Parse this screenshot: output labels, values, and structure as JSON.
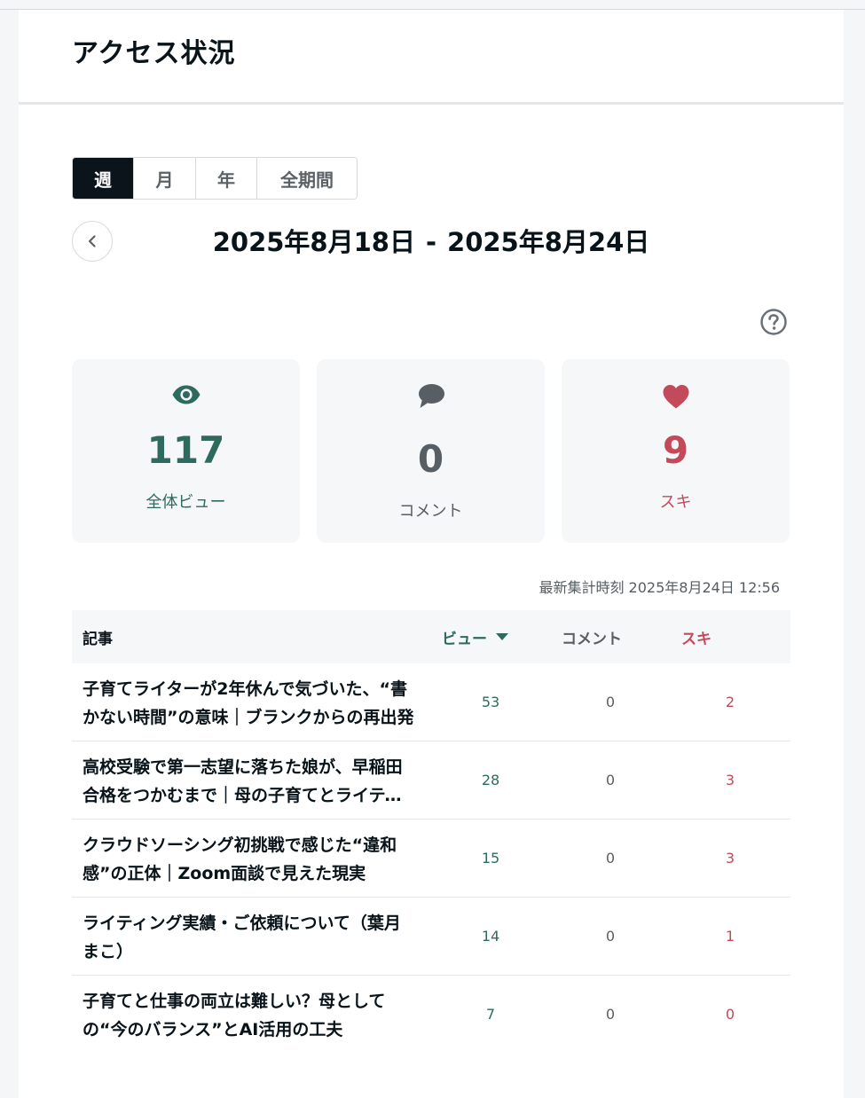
{
  "page": {
    "title": "アクセス状況"
  },
  "period_tabs": [
    {
      "label": "週",
      "active": true
    },
    {
      "label": "月",
      "active": false
    },
    {
      "label": "年",
      "active": false
    },
    {
      "label": "全期間",
      "active": false
    }
  ],
  "date_range": {
    "start": "2025年8月18日",
    "separator": "-",
    "end": "2025年8月24日"
  },
  "stats": {
    "views": {
      "value": "117",
      "label": "全体ビュー",
      "icon": "eye-icon",
      "color": "#2e6b5e"
    },
    "comments": {
      "value": "0",
      "label": "コメント",
      "icon": "speech-bubble-icon",
      "color": "#585f64"
    },
    "likes": {
      "value": "9",
      "label": "スキ",
      "icon": "heart-icon",
      "color": "#c34a5a"
    }
  },
  "updated_at": "最新集計時刻 2025年8月24日 12:56",
  "table": {
    "headers": {
      "article": "記事",
      "views": "ビュー",
      "comments": "コメント",
      "likes": "スキ"
    },
    "rows": [
      {
        "title": "子育てライターが2年休んで気づいた、“書かない時間”の意味｜ブランクからの再出発",
        "views": "53",
        "comments": "0",
        "likes": "2"
      },
      {
        "title": "高校受験で第一志望に落ちた娘が、早稲田合格をつかむまで｜母の子育てとライティング",
        "views": "28",
        "comments": "0",
        "likes": "3"
      },
      {
        "title": "クラウドソーシング初挑戦で感じた“違和感”の正体｜Zoom面談で見えた現実",
        "views": "15",
        "comments": "0",
        "likes": "3"
      },
      {
        "title": "ライティング実績・ご依頼について（葉月まこ）",
        "views": "14",
        "comments": "0",
        "likes": "1"
      },
      {
        "title": "子育てと仕事の両立は難しい？母としての“今のバランス”とAI活用の工夫",
        "views": "7",
        "comments": "0",
        "likes": "0"
      }
    ]
  },
  "colors": {
    "views": "#2e6b5e",
    "comments": "#585f64",
    "likes": "#c34a5a"
  }
}
